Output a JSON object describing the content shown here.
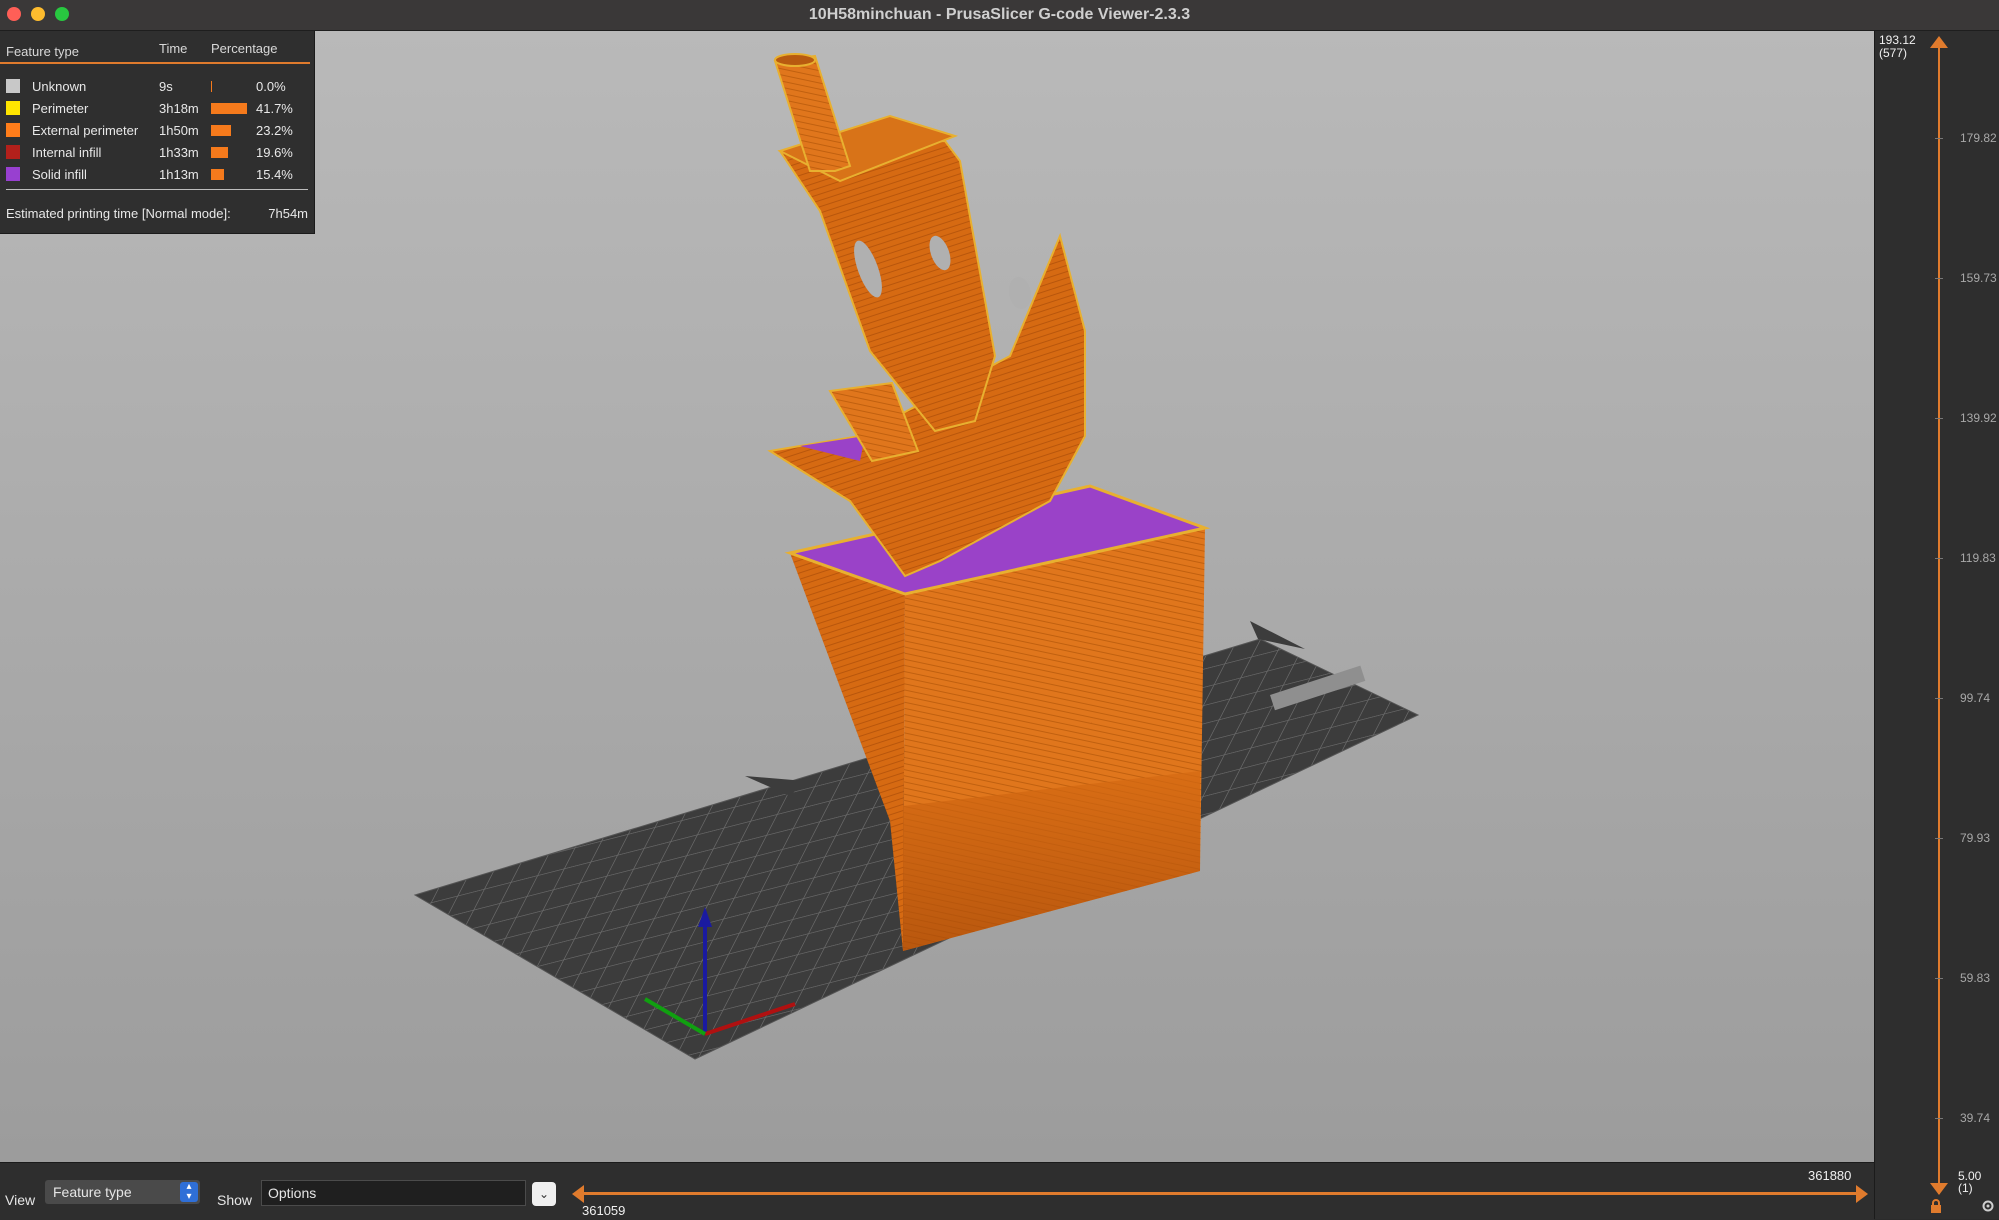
{
  "window": {
    "title": "10H58minchuan - PrusaSlicer G-code Viewer-2.3.3"
  },
  "legend": {
    "headers": {
      "feature": "Feature type",
      "time": "Time",
      "percentage": "Percentage"
    },
    "rows": [
      {
        "label": "Unknown",
        "time": "9s",
        "percent": "0.0%",
        "fraction": 0.0,
        "color": "#c8c8c8"
      },
      {
        "label": "Perimeter",
        "time": "3h18m",
        "percent": "41.7%",
        "fraction": 0.417,
        "color": "#ffe500"
      },
      {
        "label": "External perimeter",
        "time": "1h50m",
        "percent": "23.2%",
        "fraction": 0.232,
        "color": "#ff7d1a"
      },
      {
        "label": "Internal infill",
        "time": "1h33m",
        "percent": "19.6%",
        "fraction": 0.196,
        "color": "#b3201b"
      },
      {
        "label": "Solid infill",
        "time": "1h13m",
        "percent": "15.4%",
        "fraction": 0.154,
        "color": "#9840d0"
      }
    ],
    "estimate_label": "Estimated printing time [Normal mode]:",
    "estimate_value": "7h54m",
    "bar_color": "#f57a1c"
  },
  "layer_slider": {
    "top_value": "193.12",
    "top_layer": "(577)",
    "ticks": [
      "179.82",
      "159.73",
      "139.92",
      "119.83",
      "99.74",
      "79.93",
      "59.83",
      "39.74"
    ],
    "bottom_value": "5.00",
    "bottom_layer": "(1)",
    "accent": "#e07b2d"
  },
  "bottom": {
    "view_label": "View",
    "view_value": "Feature type",
    "show_label": "Show",
    "options_value": "Options",
    "move_start": "361059",
    "move_end": "361880"
  }
}
